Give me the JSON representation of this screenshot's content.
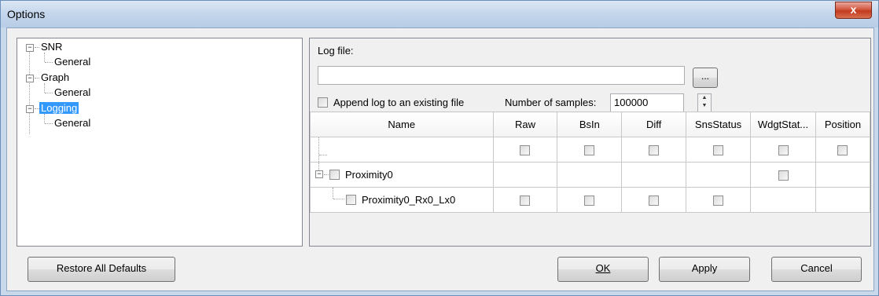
{
  "window": {
    "title": "Options",
    "close_glyph": "x"
  },
  "tree": {
    "nodes": [
      {
        "label": "SNR",
        "expander": "−",
        "children": [
          {
            "label": "General"
          }
        ]
      },
      {
        "label": "Graph",
        "expander": "−",
        "children": [
          {
            "label": "General"
          }
        ]
      },
      {
        "label": "Logging",
        "expander": "−",
        "selected": true,
        "children": [
          {
            "label": "General"
          }
        ]
      }
    ]
  },
  "logging": {
    "log_file_label": "Log file:",
    "log_file_value": "",
    "browse_label": "...",
    "append_label": "Append log to an existing file",
    "append_checked": false,
    "samples_label": "Number of samples:",
    "samples_value": "100000",
    "spin_up": "▲",
    "spin_down": "▼"
  },
  "grid": {
    "columns": [
      "Name",
      "Raw",
      "BsIn",
      "Diff",
      "SnsStatus",
      "WdgtStat...",
      "Position"
    ],
    "rows": [
      {
        "name": "",
        "type": "root"
      },
      {
        "name": "Proximity0",
        "type": "widget",
        "expander": "−"
      },
      {
        "name": "Proximity0_Rx0_Lx0",
        "type": "sensor"
      }
    ]
  },
  "buttons": {
    "restore": "Restore All Defaults",
    "ok": "OK",
    "apply": "Apply",
    "cancel": "Cancel"
  }
}
